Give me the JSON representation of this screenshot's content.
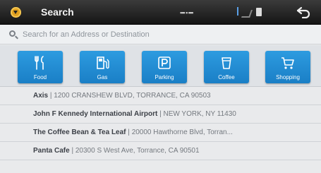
{
  "header": {
    "title": "Search"
  },
  "search": {
    "placeholder": "Search for an Address or Destination"
  },
  "categories": [
    {
      "label": "Food",
      "icon": "fork-knife-icon"
    },
    {
      "label": "Gas",
      "icon": "gas-pump-icon"
    },
    {
      "label": "Parking",
      "icon": "parking-icon"
    },
    {
      "label": "Coffee",
      "icon": "coffee-cup-icon"
    },
    {
      "label": "Shopping",
      "icon": "shopping-cart-icon"
    }
  ],
  "results": [
    {
      "name": "Axis",
      "address": "1200 CRANSHEW BLVD, TORRANCE, CA 90503"
    },
    {
      "name": "John F Kennedy International Airport",
      "address": "NEW YORK, NY 11430"
    },
    {
      "name": "The Coffee Bean & Tea Leaf",
      "address": "20000 Hawthorne Blvd, Torran..."
    },
    {
      "name": "Panta Cafe",
      "address": "20300 S West Ave, Torrance, CA 90501"
    }
  ],
  "colors": {
    "accent": "#2d9be0",
    "topbar": "#2a2a2a",
    "menu": "#e0a020"
  }
}
